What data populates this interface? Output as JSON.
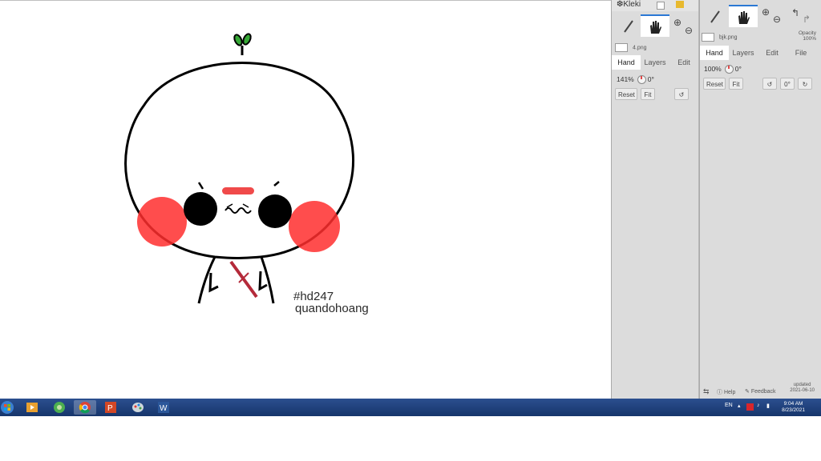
{
  "canvas": {
    "signature": {
      "tag": "#hd247",
      "author": "quandohoang"
    },
    "colors": {
      "blush": "#ff3b3b",
      "nose": "#f04a4a",
      "line": "#000000",
      "sprout": "#2e8b2e"
    }
  },
  "panel_left": {
    "app_name": "Kleki",
    "file_name": "4.png",
    "tabs": [
      "Hand",
      "Layers",
      "Edit"
    ],
    "active_tab": "Hand",
    "zoom": "141%",
    "angle": "0°",
    "reset_label": "Reset",
    "fit_label": "Fit",
    "zoom_in": "⊕",
    "zoom_out": "⊖"
  },
  "panel_right": {
    "file_name": "bjk.png",
    "opacity_label": "Opacity",
    "opacity_value": "100%",
    "tabs": [
      "Hand",
      "Layers",
      "Edit",
      "File"
    ],
    "active_tab": "Hand",
    "zoom": "100%",
    "angle": "0°",
    "reset_label": "Reset",
    "fit_label": "Fit",
    "angle_button": "0°",
    "zoom_in": "⊕",
    "zoom_out": "⊖",
    "help_label": "Help",
    "feedback_label": "Feedback",
    "updated_label": "updated",
    "updated_date": "2021-06-10"
  },
  "taskbar": {
    "lang": "EN",
    "time": "9:04 AM",
    "date": "8/23/2021",
    "accent": "#1f4380"
  }
}
